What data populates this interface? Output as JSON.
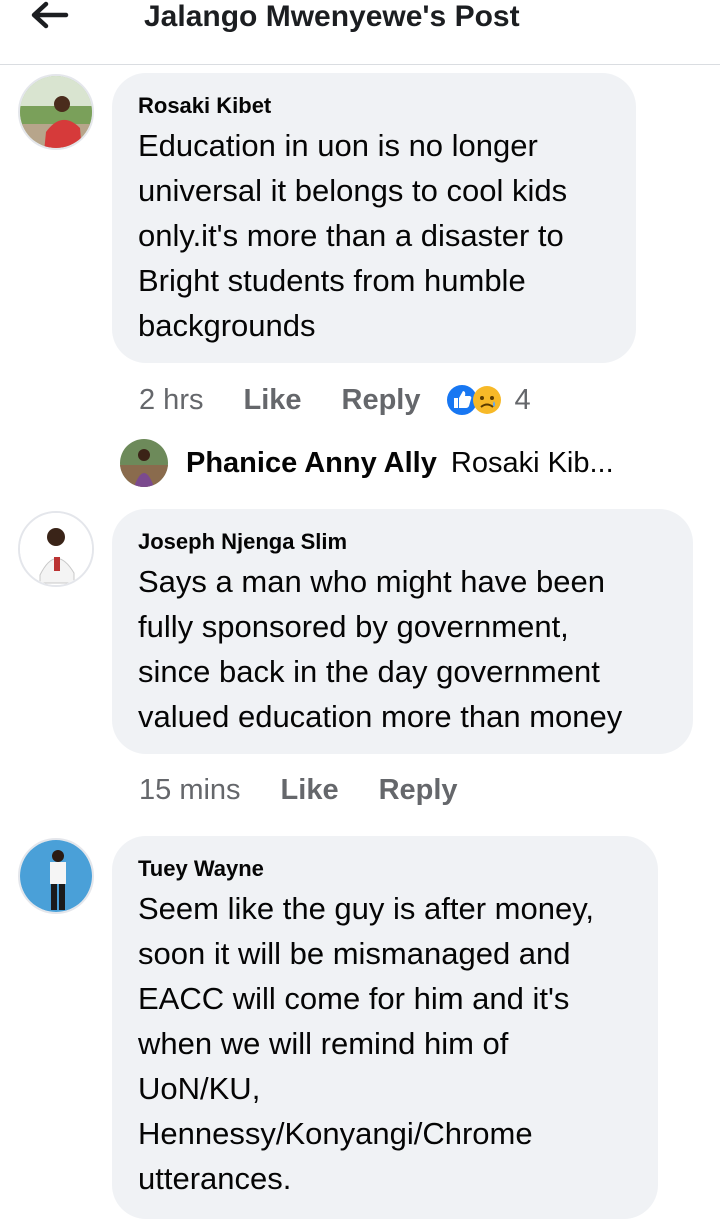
{
  "header": {
    "title": "Jalango Mwenyewe's Post",
    "back_icon": "back-arrow-icon"
  },
  "comments": [
    {
      "author": "Rosaki Kibet",
      "lines": [
        "Education in uon is no longer",
        "universal it belongs to cool kids",
        "only.it's more than a disaster to",
        "Bright students from humble",
        "backgrounds"
      ],
      "time": "2 hrs",
      "like": "Like",
      "reply": "Reply",
      "reactions": [
        "like-reaction-icon",
        "sad-reaction-icon"
      ],
      "reaction_count": "4"
    },
    {
      "author": "Joseph Njenga Slim",
      "lines": [
        "Says a man who might have been",
        "fully sponsored by government,",
        "since back in the day government",
        "valued education more than money"
      ],
      "time": "15 mins",
      "like": "Like",
      "reply": "Reply"
    },
    {
      "author": "Tuey Wayne",
      "lines": [
        "Seem like the guy is after money,",
        "soon it will be mismanaged and",
        "EACC will come for him and it's",
        "when we will remind him of",
        "UoN/KU,",
        "Hennessy/Konyangi/Chrome",
        "utterances."
      ]
    }
  ],
  "reply_preview": {
    "name": "Phanice Anny Ally",
    "snippet": "Rosaki Kib..."
  },
  "colors": {
    "bubble": "#f0f2f5",
    "meta": "#65676b",
    "like_blue": "#1877f2",
    "sad_yellow": "#f7b928"
  }
}
